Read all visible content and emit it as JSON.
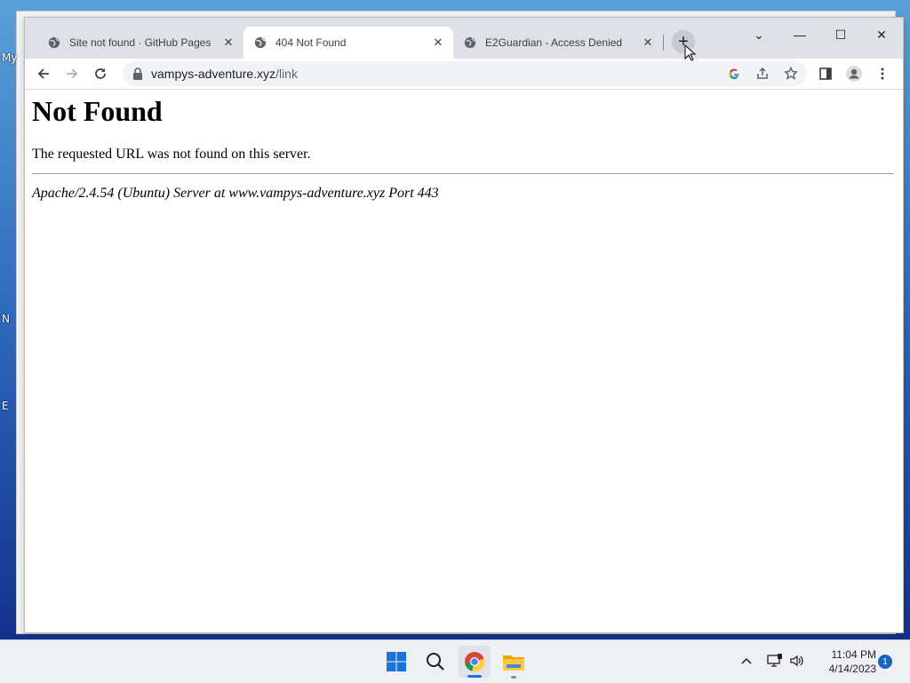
{
  "desktop": {
    "icon_labels": [
      "My",
      "N",
      "E"
    ]
  },
  "browser": {
    "tabs": [
      {
        "title": "Site not found · GitHub Pages",
        "active": false
      },
      {
        "title": "404 Not Found",
        "active": true
      },
      {
        "title": "E2Guardian - Access Denied",
        "active": false
      }
    ],
    "new_tab_label": "+",
    "window_controls": {
      "tab_search": "⌄",
      "minimize": "—",
      "maximize": "☐",
      "close": "✕"
    },
    "omnibox": {
      "host": "vampys-adventure.xyz",
      "path": "/link"
    }
  },
  "page": {
    "heading": "Not Found",
    "message": "The requested URL was not found on this server.",
    "server_signature": "Apache/2.4.54 (Ubuntu) Server at www.vampys-adventure.xyz Port 443"
  },
  "taskbar": {
    "time": "11:04 PM",
    "date": "4/14/2023",
    "notification_count": "1"
  },
  "colors": {
    "tabstrip": "#dee1e6",
    "chrome_accent": "#1a73e8",
    "notif_badge": "#1565c0"
  }
}
